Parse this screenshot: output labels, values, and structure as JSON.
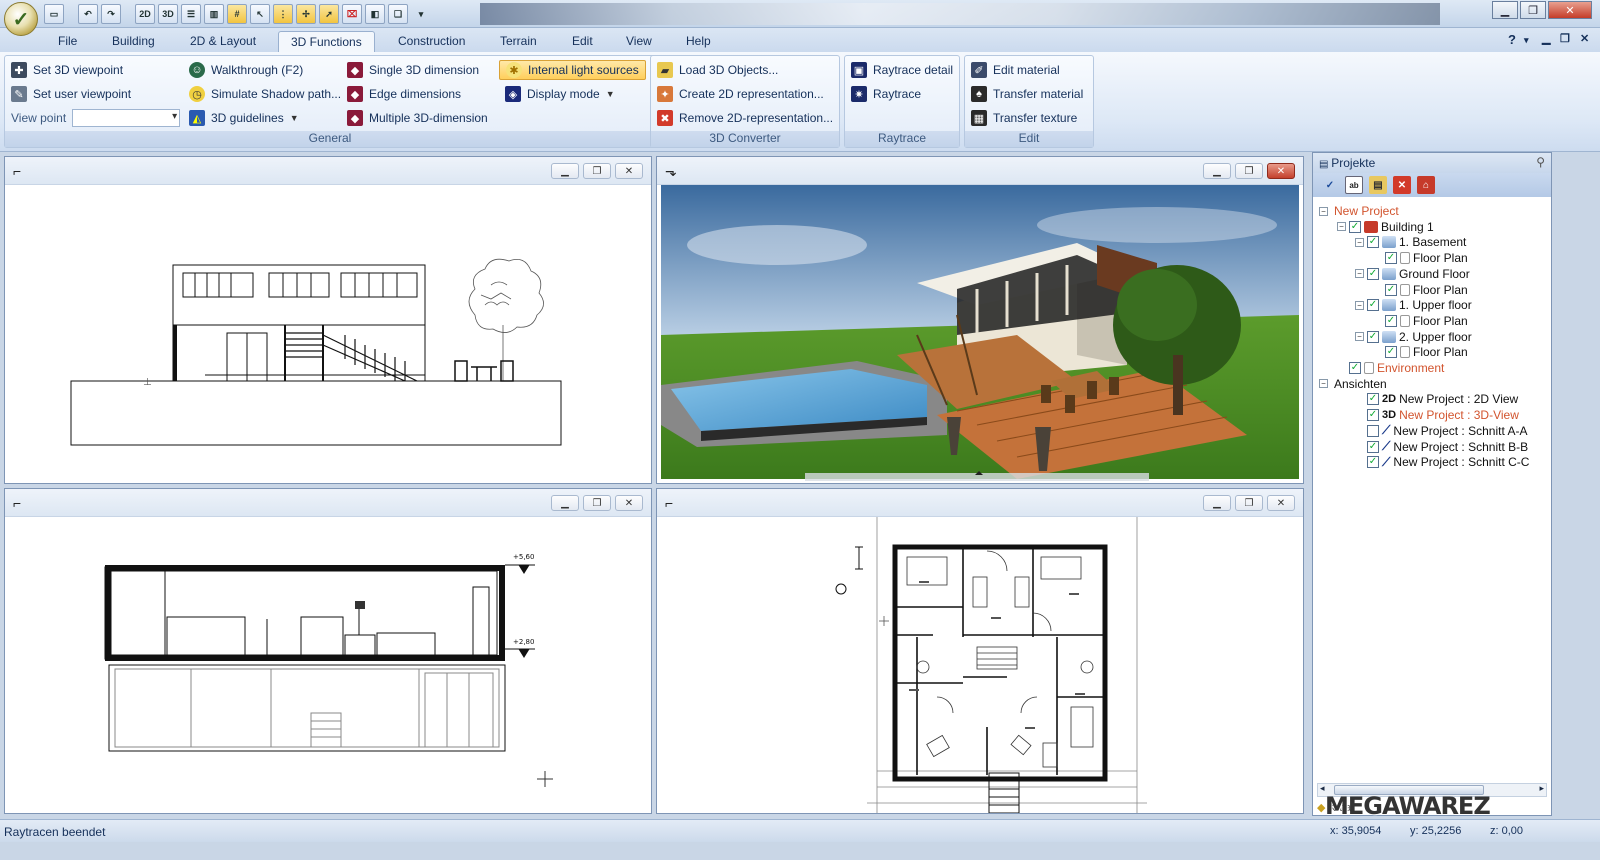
{
  "titlebar": {
    "quick_access": [
      "new-doc",
      "undo",
      "redo",
      "2D",
      "3D",
      "walls",
      "windows",
      "grid",
      "select",
      "columns",
      "snap",
      "pointer",
      "eraser",
      "layers",
      "copy"
    ],
    "qa_2d": "2D",
    "qa_3d": "3D",
    "minimize": "▁",
    "maximize": "❐",
    "close": "✕"
  },
  "menu": {
    "tabs": [
      "File",
      "Building",
      "2D & Layout",
      "3D Functions",
      "Construction",
      "Terrain",
      "Edit",
      "View",
      "Help"
    ],
    "active_tab": "3D Functions",
    "help_symbol": "?"
  },
  "ribbon": {
    "general": {
      "label": "General",
      "set_3d_viewpoint": "Set 3D viewpoint",
      "set_user_viewpoint": "Set user viewpoint",
      "view_point": "View point",
      "view_point_value": "",
      "walkthrough": "Walkthrough (F2)",
      "simulate_shadow": "Simulate Shadow path...",
      "guidelines_3d": "3D guidelines",
      "single_3d_dimension": "Single 3D dimension",
      "edge_dimensions": "Edge dimensions",
      "multiple_3d_dimension": "Multiple 3D-dimension",
      "internal_light_sources": "Internal light sources",
      "display_mode": "Display mode"
    },
    "converter": {
      "label": "3D Converter",
      "load_3d_objects": "Load 3D Objects...",
      "create_2d": "Create 2D representation...",
      "remove_2d": "Remove 2D-representation..."
    },
    "raytrace": {
      "label": "Raytrace",
      "raytrace_detail": "Raytrace detail",
      "raytrace": "Raytrace"
    },
    "edit": {
      "label": "Edit",
      "edit_material": "Edit material",
      "transfer_material": "Transfer material",
      "transfer_texture": "Transfer texture"
    }
  },
  "viewports": {
    "min": "▁",
    "max": "❐",
    "close": "✕",
    "elevation_labels": [
      "+5,60",
      "+2,80"
    ]
  },
  "project_panel": {
    "title": "Projekte",
    "tree": [
      {
        "label": "New Project",
        "level": 0,
        "checked": null,
        "color": "red",
        "expander": "-"
      },
      {
        "label": "Building 1",
        "level": 1,
        "checked": true,
        "color": "normal",
        "expander": "-"
      },
      {
        "label": "1. Basement",
        "level": 2,
        "checked": true,
        "color": "normal",
        "expander": "-"
      },
      {
        "label": "Floor Plan",
        "level": 3,
        "checked": true,
        "color": "normal",
        "expander": ""
      },
      {
        "label": "Ground Floor",
        "level": 2,
        "checked": true,
        "color": "normal",
        "expander": "-"
      },
      {
        "label": "Floor Plan",
        "level": 3,
        "checked": true,
        "color": "normal",
        "expander": ""
      },
      {
        "label": "1. Upper floor",
        "level": 2,
        "checked": true,
        "color": "normal",
        "expander": "-"
      },
      {
        "label": "Floor Plan",
        "level": 3,
        "checked": true,
        "color": "normal",
        "expander": ""
      },
      {
        "label": "2. Upper floor",
        "level": 2,
        "checked": true,
        "color": "normal",
        "expander": "-"
      },
      {
        "label": "Floor Plan",
        "level": 3,
        "checked": true,
        "color": "normal",
        "expander": ""
      },
      {
        "label": "Environment",
        "level": 1,
        "checked": true,
        "color": "red",
        "expander": ""
      },
      {
        "label": "Ansichten",
        "level": 0,
        "checked": null,
        "color": "normal",
        "expander": "-"
      },
      {
        "label": "New Project : 2D View",
        "level": 2,
        "checked": true,
        "color": "normal",
        "expander": "",
        "prefix": "2D"
      },
      {
        "label": "New Project : 3D-View",
        "level": 2,
        "checked": true,
        "color": "red",
        "expander": "",
        "prefix": "3D"
      },
      {
        "label": "New Project : Schnitt A-A",
        "level": 2,
        "checked": false,
        "color": "normal",
        "expander": "",
        "prefix": "cut"
      },
      {
        "label": "New Project : Schnitt B-B",
        "level": 2,
        "checked": true,
        "color": "normal",
        "expander": "",
        "prefix": "cut"
      },
      {
        "label": "New Project : Schnitt C-C",
        "level": 2,
        "checked": true,
        "color": "normal",
        "expander": "",
        "prefix": "cut"
      }
    ],
    "bottom_tab": "Kata"
  },
  "status": {
    "message": "Raytracen beendet",
    "x": "x: 35,9054",
    "y": "y: 25,2256",
    "z": "z: 0,00"
  },
  "watermark": "MEGAWAREZ",
  "colors": {
    "accent": "#d2542e",
    "ribbon_bg": "#dde8f6",
    "highlight": "#ffcf5c"
  }
}
